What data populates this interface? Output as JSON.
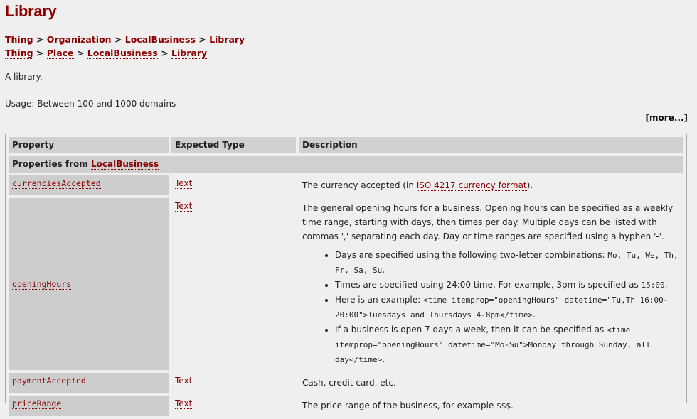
{
  "title": "Library",
  "breadcrumbs": [
    [
      "Thing",
      "Organization",
      "LocalBusiness",
      "Library"
    ],
    [
      "Thing",
      "Place",
      "LocalBusiness",
      "Library"
    ]
  ],
  "separator": ">",
  "description": "A library.",
  "usage": "Usage: Between 100 and 1000 domains",
  "more": "[more...]",
  "table": {
    "headers": [
      "Property",
      "Expected Type",
      "Description"
    ],
    "group_prefix": "Properties from",
    "group_link": "LocalBusiness",
    "rows": [
      {
        "property": "currenciesAccepted",
        "type": "Text",
        "desc_pre": "The currency accepted (in ",
        "desc_link": "ISO 4217 currency format",
        "desc_post": ")."
      },
      {
        "property": "openingHours",
        "type": "Text",
        "desc": "The general opening hours for a business. Opening hours can be specified as a weekly time range, starting with days, then times per day. Multiple days can be listed with commas ',' separating each day. Day or time ranges are specified using a hyphen '-'.",
        "bullets": [
          {
            "text": "Days are specified using the following two-letter combinations: ",
            "code": "Mo, Tu, We, Th, Fr, Sa, Su",
            "after": "."
          },
          {
            "text": "Times are specified using 24:00 time. For example, 3pm is specified as ",
            "code": "15:00",
            "after": "."
          },
          {
            "text": "Here is an example: ",
            "code": "<time itemprop=\"openingHours\" datetime=\"Tu,Th 16:00-20:00\">Tuesdays and Thursdays 4-8pm</time>",
            "after": "."
          },
          {
            "text": "If a business is open 7 days a week, then it can be specified as ",
            "code": "<time itemprop=\"openingHours\" datetime=\"Mo-Su\">Monday through Sunday, all day</time>",
            "after": "."
          }
        ]
      },
      {
        "property": "paymentAccepted",
        "type": "Text",
        "desc": "Cash, credit card, etc."
      },
      {
        "property": "priceRange",
        "type": "Text",
        "desc_pre": "The price range of the business, for example ",
        "desc_code": "$$$",
        "desc_post": "."
      }
    ]
  }
}
